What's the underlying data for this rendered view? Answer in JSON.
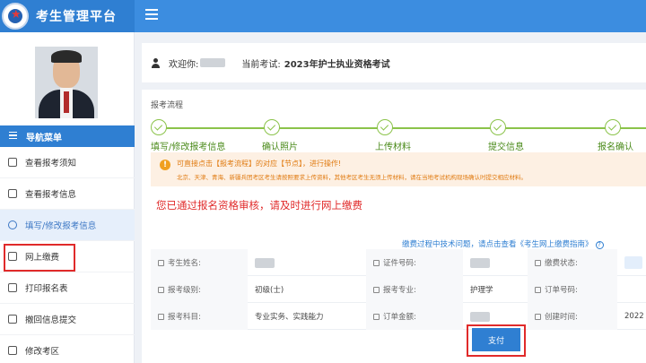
{
  "header": {
    "app_title": "考生管理平台"
  },
  "sidebar": {
    "nav_title": "导航菜单",
    "items": [
      {
        "label": "查看报考须知"
      },
      {
        "label": "查看报考信息"
      },
      {
        "label": "填写/修改报考信息"
      },
      {
        "label": "网上缴费"
      },
      {
        "label": "打印报名表"
      },
      {
        "label": "撤回信息提交"
      },
      {
        "label": "修改考区"
      }
    ]
  },
  "welcome": {
    "greeting": "欢迎你:",
    "exam_label": "当前考试:",
    "exam_name": "2023年护士执业资格考试"
  },
  "process": {
    "title": "报考流程",
    "steps": [
      {
        "label": "填写/修改报考信息"
      },
      {
        "label": "确认照片"
      },
      {
        "label": "上传材料"
      },
      {
        "label": "提交信息"
      },
      {
        "label": "报名确认"
      }
    ]
  },
  "alert": {
    "line1": "可直接点击【报考流程】的对应【节点】，进行操作!",
    "line2": "北京、天津、青海、新疆兵团考区考生请按照要求上传资料，其他考区考生无须上传材料，请在当地考试机构现场确认时提交相应材料。"
  },
  "status_message": "您已通过报名资格审核，请及时进行网上缴费",
  "help_link": "缴费过程中技术问题，请点击查看《考生网上缴费指南》",
  "info": {
    "rows": [
      [
        {
          "label": "考生姓名:",
          "value": ""
        },
        {
          "label": "证件号码:",
          "value": ""
        },
        {
          "label": "缴费状态:",
          "value": ""
        }
      ],
      [
        {
          "label": "报考级别:",
          "value": "初级(士)"
        },
        {
          "label": "报考专业:",
          "value": "护理学"
        },
        {
          "label": "订单号码:",
          "value": ""
        }
      ],
      [
        {
          "label": "报考科目:",
          "value": "专业实务、实践能力"
        },
        {
          "label": "订单金额:",
          "value": ""
        },
        {
          "label": "创建时间:",
          "value": "2022"
        }
      ]
    ]
  },
  "pay_button": "支付",
  "colors": {
    "primary": "#2f7fd2",
    "header": "#3c8de0",
    "highlight_red": "#e02a2a",
    "step_green": "#8bc34a",
    "warn_orange": "#e07a10"
  }
}
